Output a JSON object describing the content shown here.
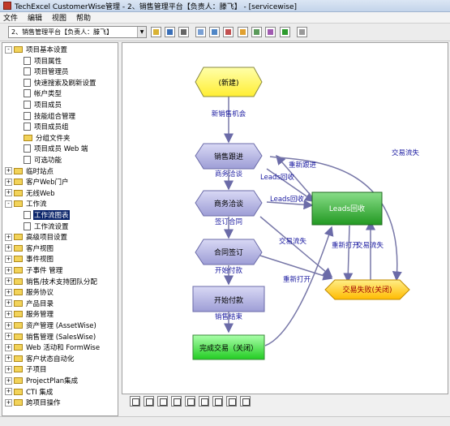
{
  "window": {
    "title": "TechExcel CustomerWise管理 - 2、销售管理平台【负责人：滕飞】 - [servicewise]"
  },
  "menu": [
    "文件",
    "编辑",
    "视图",
    "帮助"
  ],
  "toolbar": {
    "project_select": "2、销售管理平台【负责人：滕飞】"
  },
  "tree": {
    "items": [
      {
        "label": "项目基本设置",
        "level": 0,
        "type": "folder",
        "expander": "-"
      },
      {
        "label": "项目属性",
        "level": 1,
        "type": "doc"
      },
      {
        "label": "项目管理员",
        "level": 1,
        "type": "doc"
      },
      {
        "label": "快速搜索及刷新设置",
        "level": 1,
        "type": "doc"
      },
      {
        "label": "帐户类型",
        "level": 1,
        "type": "doc"
      },
      {
        "label": "项目成员",
        "level": 1,
        "type": "doc"
      },
      {
        "label": "技能组合管理",
        "level": 1,
        "type": "doc"
      },
      {
        "label": "项目成员组",
        "level": 1,
        "type": "doc"
      },
      {
        "label": "分组文件夹",
        "level": 1,
        "type": "folder"
      },
      {
        "label": "项目成员 Web 端",
        "level": 1,
        "type": "doc"
      },
      {
        "label": "可选功能",
        "level": 1,
        "type": "doc"
      },
      {
        "label": "临时站点",
        "level": 0,
        "type": "folder",
        "expander": "+"
      },
      {
        "label": "客户Web门户",
        "level": 0,
        "type": "folder",
        "expander": "+"
      },
      {
        "label": "无线Web",
        "level": 0,
        "type": "folder",
        "expander": "+"
      },
      {
        "label": "工作流",
        "level": 0,
        "type": "folder",
        "expander": "-"
      },
      {
        "label": "工作流图表",
        "level": 1,
        "type": "doc",
        "selected": true
      },
      {
        "label": "工作流设置",
        "level": 1,
        "type": "doc"
      },
      {
        "label": "高级项目设置",
        "level": 0,
        "type": "folder",
        "expander": "+"
      },
      {
        "label": "客户视图",
        "level": 0,
        "type": "folder",
        "expander": "+"
      },
      {
        "label": "事件视图",
        "level": 0,
        "type": "folder",
        "expander": "+"
      },
      {
        "label": "子事件 管理",
        "level": 0,
        "type": "folder",
        "expander": "+"
      },
      {
        "label": "销售/技术支持团队分配",
        "level": 0,
        "type": "folder",
        "expander": "+"
      },
      {
        "label": "服务协议",
        "level": 0,
        "type": "folder",
        "expander": "+"
      },
      {
        "label": "产品目录",
        "level": 0,
        "type": "folder",
        "expander": "+"
      },
      {
        "label": "服务管理",
        "level": 0,
        "type": "folder",
        "expander": "+"
      },
      {
        "label": "资产管理 (AssetWise)",
        "level": 0,
        "type": "folder",
        "expander": "+"
      },
      {
        "label": "销售管理 (SalesWise)",
        "level": 0,
        "type": "folder",
        "expander": "+"
      },
      {
        "label": "Web 活动和 FormWise",
        "level": 0,
        "type": "folder",
        "expander": "+"
      },
      {
        "label": "客户状态自动化",
        "level": 0,
        "type": "folder",
        "expander": "+"
      },
      {
        "label": "子项目",
        "level": 0,
        "type": "folder",
        "expander": "+"
      },
      {
        "label": "ProjectPlan集成",
        "level": 0,
        "type": "folder",
        "expander": "+"
      },
      {
        "label": "CTI 集成",
        "level": 0,
        "type": "folder",
        "expander": "+"
      },
      {
        "label": "跨项目操作",
        "level": 0,
        "type": "folder",
        "expander": "+"
      }
    ]
  },
  "workflow": {
    "nodes": {
      "new": "(新建)",
      "follow": "销售跟进",
      "negotiate": "商务洽谈",
      "contract": "合同签订",
      "invoice": "开始付款",
      "done": "完成交易（关闭）",
      "leads": "Leads回收",
      "fail": "交易失败(关闭)"
    },
    "edges": {
      "new_opportunity": "新销售机会",
      "biz_talk": "商务洽谈",
      "sign": "签订合同",
      "start_pay": "开始付款",
      "sale_end": "销售结束",
      "leads_recycle_1": "Leads回收",
      "leads_recycle_2": "Leads回收",
      "re_follow": "重新跟进",
      "deal_fail_top": "交易流失",
      "deal_fail_mid": "交易流失",
      "reopen_fail": "重新打开",
      "deal_fail_2": "交易流失",
      "reopen": "重新打开"
    }
  },
  "colors": {
    "title_bar": "#c3d4ea",
    "selection": "#0a246a",
    "node_new": "#ffff66",
    "node_stage": "#b3b3e6",
    "node_done": "#33cc33",
    "node_leads": "#33aa33",
    "node_fail": "#ffcc00",
    "edge": "#8080a0",
    "edge_label": "#0000aa"
  },
  "toolbar_icons": [
    "open-icon",
    "save-icon",
    "print-icon",
    "print-preview-icon",
    "window-icon",
    "tile-icon",
    "users-icon",
    "search-icon",
    "tools-icon",
    "chart-icon",
    "help-icon"
  ],
  "bottom_icons": [
    "pointer-icon",
    "zoom-out-icon",
    "zoom-in-icon",
    "zoom-fit-icon",
    "layout-icon",
    "image-icon",
    "export-icon",
    "wmf-icon",
    "grid-icon"
  ]
}
